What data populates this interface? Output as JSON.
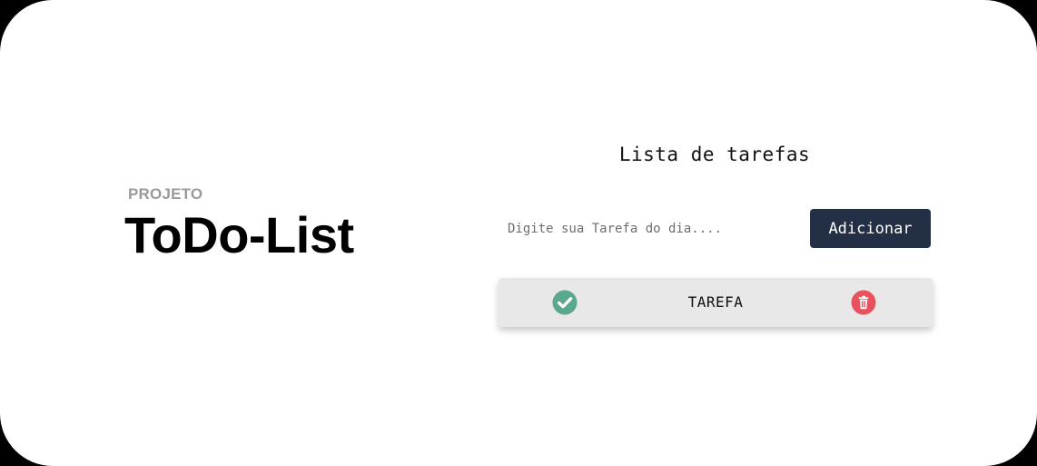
{
  "project": {
    "label": "PROJETO",
    "title": "ToDo-List"
  },
  "todo": {
    "heading": "Lista de tarefas",
    "input": {
      "placeholder": "Digite sua Tarefa do dia....",
      "value": ""
    },
    "add_label": "Adicionar",
    "tasks": [
      {
        "text": "TAREFA",
        "done_icon": "check-circle-icon",
        "delete_icon": "trash-icon"
      }
    ]
  },
  "colors": {
    "button_bg": "#232f45",
    "check_green": "#5aa88d",
    "delete_red": "#e8525e",
    "task_bg": "#e8e8e8"
  }
}
